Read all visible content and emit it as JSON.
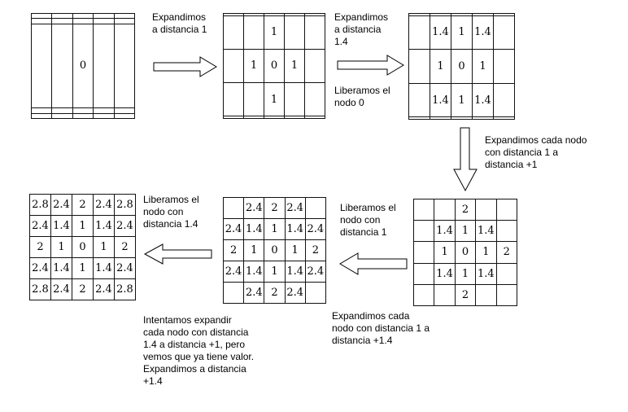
{
  "grids": [
    {
      "id": "grid-initial",
      "cells": [
        [
          "",
          "",
          "",
          "",
          ""
        ],
        [
          "",
          "",
          "",
          "",
          ""
        ],
        [
          "",
          "",
          "0",
          "",
          ""
        ],
        [
          "",
          "",
          "",
          "",
          ""
        ],
        [
          "",
          "",
          "",
          "",
          ""
        ]
      ]
    },
    {
      "id": "grid-step1",
      "cells": [
        [
          "",
          "",
          "",
          "",
          ""
        ],
        [
          "",
          "",
          "1",
          "",
          ""
        ],
        [
          "",
          "1",
          "0",
          "1",
          ""
        ],
        [
          "",
          "",
          "1",
          "",
          ""
        ],
        [
          "",
          "",
          "",
          "",
          ""
        ]
      ]
    },
    {
      "id": "grid-step2",
      "cells": [
        [
          "",
          "",
          "",
          "",
          ""
        ],
        [
          "",
          "1.4",
          "1",
          "1.4",
          ""
        ],
        [
          "",
          "1",
          "0",
          "1",
          ""
        ],
        [
          "",
          "1.4",
          "1",
          "1.4",
          ""
        ],
        [
          "",
          "",
          "",
          "",
          ""
        ]
      ]
    },
    {
      "id": "grid-step3",
      "left_text": "2",
      "cells": [
        [
          "",
          "",
          "2",
          "",
          ""
        ],
        [
          "",
          "1.4",
          "1",
          "1.4",
          ""
        ],
        [
          "",
          "1",
          "0",
          "1",
          "2"
        ],
        [
          "",
          "1.4",
          "1",
          "1.4",
          ""
        ],
        [
          "",
          "",
          "2",
          "",
          ""
        ]
      ]
    },
    {
      "id": "grid-step4",
      "cells": [
        [
          "",
          "2.4",
          "2",
          "2.4",
          ""
        ],
        [
          "2.4",
          "1.4",
          "1",
          "1.4",
          "2.4"
        ],
        [
          "2",
          "1",
          "0",
          "1",
          "2"
        ],
        [
          "2.4",
          "1.4",
          "1",
          "1.4",
          "2.4"
        ],
        [
          "",
          "2.4",
          "2",
          "2.4",
          ""
        ]
      ]
    },
    {
      "id": "grid-final",
      "cells": [
        [
          "2.8",
          "2.4",
          "2",
          "2.4",
          "2.8"
        ],
        [
          "2.4",
          "1.4",
          "1",
          "1.4",
          "2.4"
        ],
        [
          "2",
          "1",
          "0",
          "1",
          "2"
        ],
        [
          "2.4",
          "1.4",
          "1",
          "1.4",
          "2.4"
        ],
        [
          "2.8",
          "2.4",
          "2",
          "2.4",
          "2.8"
        ]
      ]
    }
  ],
  "captions": {
    "expand_1": "Expandimos\na distancia 1",
    "expand_1_4": "Expandimos\na distancia\n1.4",
    "release_0": "Liberamos el\nnodo 0",
    "expand_each_1": "Expandimos cada nodo\ncon distancia 1 a\ndistancia +1",
    "release_1": "Liberamos el\nnodo con\ndistancia 1",
    "expand_each_1_to_1_4": "Expandimos cada\nnodo con distancia 1 a\ndistancia +1.4",
    "release_1_4": "Liberamos el\nnodo con\ndistancia 1.4",
    "try_expand": "Intentamos expandir\ncada nodo con distancia\n1.4 a distancia +1, pero\nvemos que ya tiene valor.\nExpandimos a distancia\n+1.4"
  }
}
